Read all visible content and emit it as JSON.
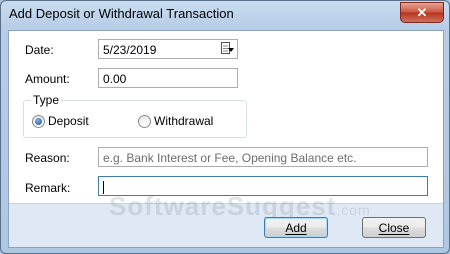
{
  "window": {
    "title": "Add Deposit or Withdrawal Transaction",
    "close_glyph": "✕"
  },
  "form": {
    "date_label": "Date:",
    "date_value": "5/23/2019",
    "amount_label": "Amount:",
    "amount_value": "0.00",
    "type_legend": "Type",
    "type_options": [
      {
        "label": "Deposit",
        "selected": true
      },
      {
        "label": "Withdrawal",
        "selected": false
      }
    ],
    "reason_label": "Reason:",
    "reason_placeholder": "e.g. Bank Interest or Fee, Opening Balance etc.",
    "remark_label": "Remark:",
    "remark_value": ""
  },
  "buttons": {
    "add_label": "Add",
    "close_label": "Close"
  },
  "watermark": {
    "text": "SoftwareSuggest",
    "suffix": ".com"
  },
  "icons": {
    "calendar": "calendar-icon",
    "dropdown": "chevron-down-icon",
    "close": "close-icon"
  }
}
